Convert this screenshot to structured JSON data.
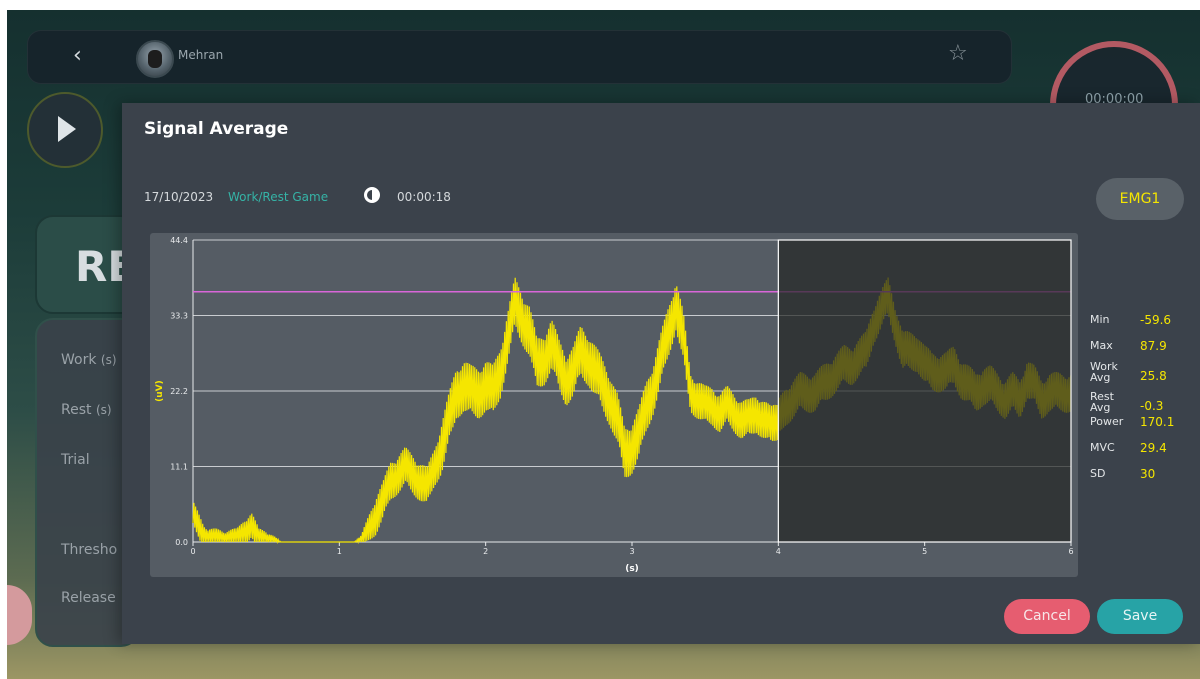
{
  "header": {
    "user_name": "Mehran",
    "timer": "00:00:00"
  },
  "side": {
    "big_label": "RE",
    "work": "Work",
    "work_unit": "(s)",
    "rest": "Rest",
    "rest_unit": "(s)",
    "trial": "Trial",
    "threshold": "Thresho",
    "release": "Release"
  },
  "modal": {
    "title": "Signal Average",
    "date": "17/10/2023",
    "game": "Work/Rest Game",
    "duration": "00:00:18",
    "channel": "EMG1",
    "cancel_label": "Cancel",
    "save_label": "Save"
  },
  "stats": [
    {
      "label": "Min",
      "value": "-59.6"
    },
    {
      "label": "Max",
      "value": "87.9"
    },
    {
      "label": "Work\nAvg",
      "value": "25.8"
    },
    {
      "label": "Rest\nAvg",
      "value": "-0.3"
    },
    {
      "label": "Power",
      "value": "170.1"
    },
    {
      "label": "MVC",
      "value": "29.4"
    },
    {
      "label": "SD",
      "value": "30"
    }
  ],
  "colors": {
    "signal": "#f5e600",
    "threshold": "#d966d9",
    "accent": "#35b3a6",
    "cancel": "#e65d70",
    "save": "#27a3a6"
  },
  "icons": [
    "back-chevron-icon",
    "star-add-icon",
    "play-icon",
    "clock-icon"
  ],
  "chart_data": {
    "type": "line",
    "xlabel": "(s)",
    "ylabel": "(uV)",
    "xlim": [
      0,
      6
    ],
    "ylim": [
      0,
      44.4
    ],
    "x_ticks": [
      0,
      1,
      2,
      3,
      4,
      5,
      6
    ],
    "y_ticks": [
      "0.0",
      "11.1",
      "22.2",
      "33.3",
      "44.4"
    ],
    "threshold": 36.8,
    "shaded_region": [
      4,
      6
    ],
    "signal": {
      "x": [
        0,
        0.05,
        0.1,
        0.15,
        0.2,
        0.25,
        0.3,
        0.35,
        0.4,
        0.45,
        0.5,
        0.6,
        0.7,
        0.8,
        0.9,
        1.0,
        1.1,
        1.15,
        1.2,
        1.25,
        1.3,
        1.35,
        1.4,
        1.45,
        1.5,
        1.55,
        1.6,
        1.65,
        1.7,
        1.75,
        1.8,
        1.85,
        1.9,
        1.95,
        2.0,
        2.05,
        2.1,
        2.15,
        2.2,
        2.25,
        2.3,
        2.35,
        2.4,
        2.45,
        2.5,
        2.55,
        2.6,
        2.65,
        2.7,
        2.75,
        2.8,
        2.85,
        2.9,
        2.95,
        3.0,
        3.05,
        3.1,
        3.15,
        3.2,
        3.25,
        3.3,
        3.35,
        3.4,
        3.45,
        3.5,
        3.55,
        3.6,
        3.65,
        3.7,
        3.75,
        3.8,
        3.85,
        3.9,
        3.95,
        4.0,
        4.05,
        4.1,
        4.15,
        4.2,
        4.25,
        4.3,
        4.35,
        4.4,
        4.45,
        4.5,
        4.55,
        4.6,
        4.65,
        4.7,
        4.75,
        4.8,
        4.85,
        4.9,
        4.95,
        5.0,
        5.05,
        5.1,
        5.15,
        5.2,
        5.25,
        5.3,
        5.35,
        5.4,
        5.45,
        5.5,
        5.55,
        5.6,
        5.65,
        5.7,
        5.75,
        5.8,
        5.85,
        5.9,
        5.95,
        6.0
      ],
      "y": [
        4,
        2,
        0,
        0,
        0,
        0,
        0,
        1.5,
        2.5,
        0,
        0,
        0,
        0,
        0,
        0,
        0,
        0,
        0,
        2,
        4,
        6,
        9,
        10,
        11,
        10,
        9,
        8,
        11,
        14,
        18,
        22,
        23,
        22,
        22,
        23,
        22,
        25,
        30,
        35,
        33,
        31,
        26,
        27,
        29,
        26,
        24,
        25,
        28,
        27,
        25,
        23,
        21,
        18,
        13,
        14,
        16,
        20,
        23,
        27,
        31,
        35,
        30,
        22,
        21,
        20,
        20,
        19,
        20,
        19,
        18,
        18,
        19,
        18,
        17,
        18,
        20,
        21,
        22,
        22,
        22,
        23,
        24,
        25,
        26,
        26,
        27,
        28,
        32,
        34,
        36,
        32,
        28,
        28,
        28,
        26,
        25,
        25,
        25,
        26,
        24,
        23,
        22,
        23,
        23,
        22,
        21,
        22,
        21,
        24,
        23,
        21,
        22,
        22,
        22,
        22
      ],
      "amplitude": [
        2,
        2,
        2,
        2,
        2,
        2,
        2,
        2,
        2,
        2,
        2,
        0,
        0,
        0,
        0,
        0,
        0,
        1,
        2,
        3,
        3,
        3,
        3,
        3,
        3,
        3,
        3,
        3,
        4,
        4,
        4,
        4,
        4,
        4,
        4,
        4,
        4,
        4,
        4,
        4,
        4,
        4,
        4,
        4,
        4,
        4,
        4,
        4,
        4,
        4,
        4,
        4,
        4,
        4,
        4,
        4,
        4,
        4,
        4,
        4,
        4,
        4,
        3,
        3,
        3,
        3,
        3,
        3,
        3,
        3,
        3,
        3,
        3,
        3,
        3,
        3,
        3,
        3,
        3,
        3,
        3,
        3,
        3,
        3,
        3,
        3,
        3,
        3,
        3,
        3,
        3,
        3,
        3,
        3,
        3,
        3,
        3,
        3,
        3,
        3,
        3,
        3,
        3,
        3,
        3,
        3,
        3,
        3,
        3,
        3,
        3,
        3,
        3,
        3,
        3,
        3,
        3,
        3,
        3,
        3,
        3
      ]
    }
  }
}
